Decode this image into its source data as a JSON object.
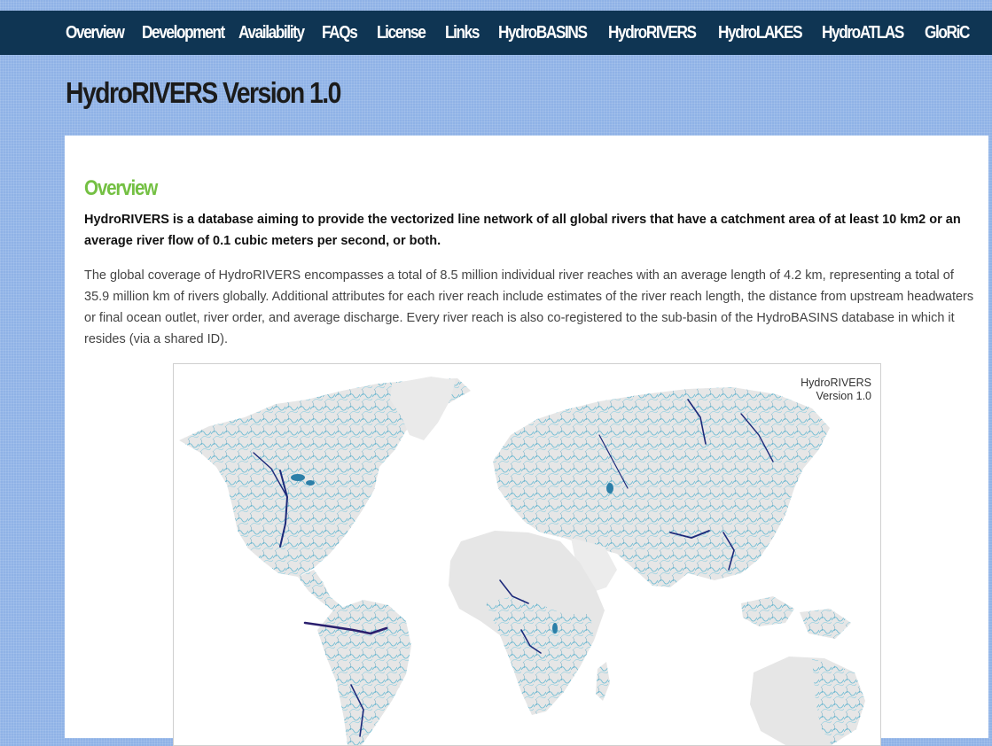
{
  "nav": {
    "items": [
      {
        "label": "Overview"
      },
      {
        "label": "Development"
      },
      {
        "label": "Availability"
      },
      {
        "label": "FAQs"
      },
      {
        "label": "License"
      },
      {
        "label": "Links"
      },
      {
        "label": "HydroBASINS"
      },
      {
        "label": "HydroRIVERS"
      },
      {
        "label": "HydroLAKES"
      },
      {
        "label": "HydroATLAS"
      },
      {
        "label": "GloRiC"
      }
    ]
  },
  "page": {
    "title": "HydroRIVERS Version 1.0"
  },
  "content": {
    "heading": "Overview",
    "intro": "HydroRIVERS is a database aiming to provide the vectorized line network of all global rivers that have a catchment area of at least 10 km2 or an average river flow of 0.1 cubic meters per second, or both.",
    "body": "The global coverage of HydroRIVERS encompasses a total of 8.5 million individual river reaches with an average length of 4.2 km, representing a total of 35.9 million km of rivers globally. Additional attributes for each river reach include estimates of the river reach length, the distance from upstream headwaters or final ocean outlet, river order, and average discharge. Every river reach is also co-registered to the sub-basin of the HydroBASINS database in which it resides (via a shared ID).",
    "map": {
      "label_line1": "HydroRIVERS",
      "label_line2": "Version 1.0"
    }
  },
  "colors": {
    "navbar": "#0f3553",
    "background": "#8fb2e6",
    "heading": "#74c043",
    "land": "#e6e6e6",
    "river": "#3fa6c8",
    "major_river": "#1d2a7a"
  }
}
